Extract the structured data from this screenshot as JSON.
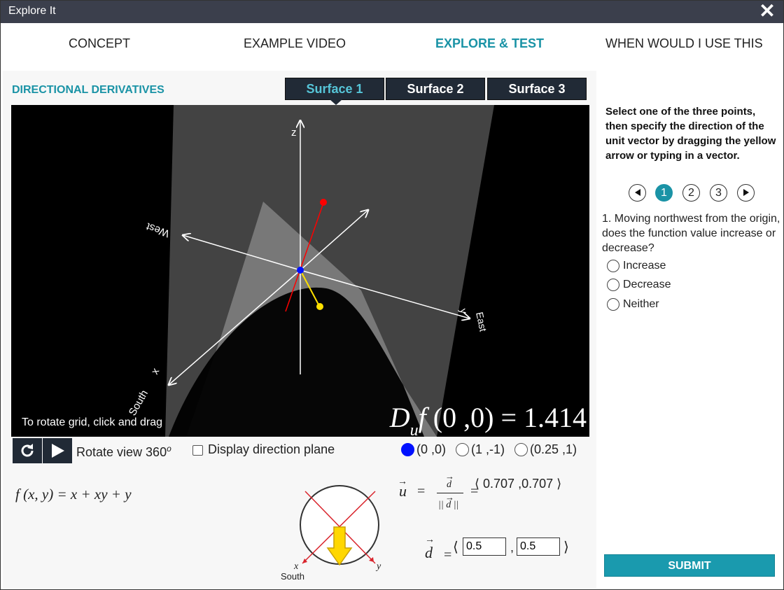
{
  "window": {
    "title": "Explore It",
    "close_symbol": "✕"
  },
  "tabs": [
    {
      "label": "CONCEPT"
    },
    {
      "label": "EXAMPLE VIDEO"
    },
    {
      "label": "EXPLORE & TEST"
    },
    {
      "label": "WHEN WOULD I USE THIS"
    }
  ],
  "active_tab": "EXPLORE & TEST",
  "section_title": "DIRECTIONAL DERIVATIVES",
  "surface_tabs": [
    {
      "label": "Surface 1"
    },
    {
      "label": "Surface 2"
    },
    {
      "label": "Surface 3"
    }
  ],
  "active_surface": "Surface 1",
  "viewer": {
    "hint": "To rotate grid, click and drag",
    "axis_labels": {
      "z": "z",
      "west": "West",
      "east": "East",
      "south": "South",
      "x": "x",
      "y": "y"
    },
    "formula": {
      "D": "D",
      "f": "f",
      "point": "(0 ,0)",
      "equals": "=",
      "value": "1.414"
    }
  },
  "controls": {
    "reset_icon": "refresh-icon",
    "play_icon": "play-icon",
    "rotate_label": "Rotate view 360",
    "rotate_sup": "o",
    "display_plane_label": "Display direction plane",
    "display_plane_checked": false,
    "points": [
      {
        "label": "(0 ,0)",
        "selected": true
      },
      {
        "label": "(1 ,-1)",
        "selected": false
      },
      {
        "label": "(0.25 ,1)",
        "selected": false
      }
    ]
  },
  "function_label": "f (x, y) = x + xy + y",
  "compass": {
    "x": "x",
    "y": "y",
    "south": "South"
  },
  "unit_vector": {
    "u": "u",
    "equals": "=",
    "numerator": "d",
    "denominator": "|| d ||",
    "result": "⟨ 0.707 ,0.707 ⟩"
  },
  "direction_vector": {
    "d": "d",
    "equals": "=",
    "open": "⟨",
    "comma": ",",
    "close": "⟩",
    "x_value": "0.5",
    "y_value": "0.5"
  },
  "sidebar": {
    "instructions": "Select one of the three points, then specify the direction of the unit vector by dragging the yellow arrow or typing in a vector.",
    "steps": [
      "1",
      "2",
      "3"
    ],
    "active_step": "1",
    "question": "1. Moving northwest from the origin, does the function value increase or decrease?",
    "options": [
      {
        "label": "Increase"
      },
      {
        "label": "Decrease"
      },
      {
        "label": "Neither"
      }
    ],
    "submit_label": "SUBMIT"
  },
  "colors": {
    "accent": "#1a93a6",
    "dark_tab": "#212a36",
    "titlebar": "#3b3f4c",
    "point_selected": "#0011ff",
    "vector_red": "#ff0000",
    "vector_yellow": "#ffe000"
  }
}
